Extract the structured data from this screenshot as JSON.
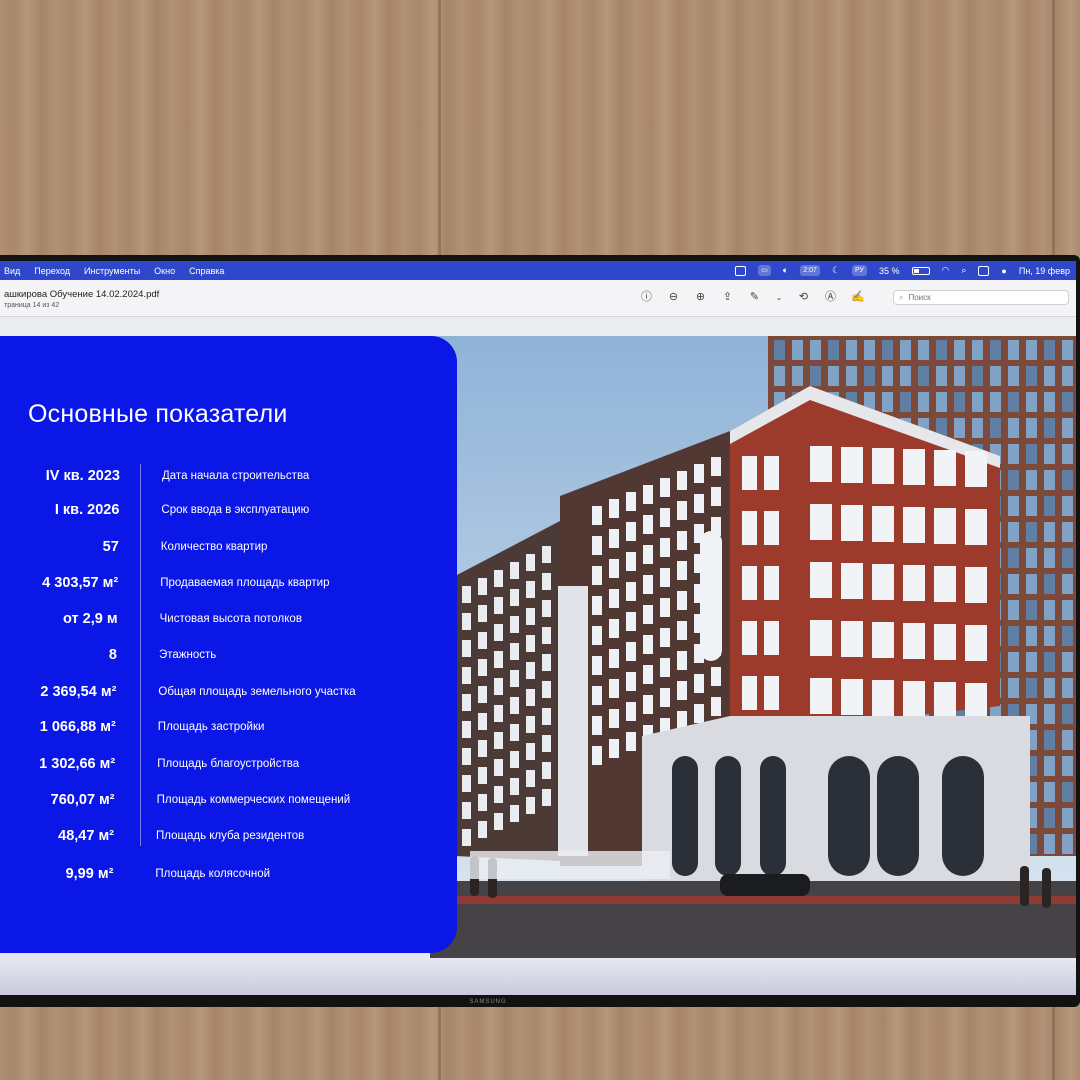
{
  "menubar": {
    "items": [
      "Вид",
      "Переход",
      "Инструменты",
      "Окно",
      "Справка"
    ],
    "status": {
      "pill_a": "2:07",
      "language": "РУ",
      "battery": "35 %",
      "clock": "Пн, 19 февр"
    }
  },
  "toolbar": {
    "doc_title": "ашкирова Обучение 14.02.2024.pdf",
    "page_info": "траница 14 из 42",
    "search_placeholder": "Поиск",
    "icons": [
      "info-icon",
      "zoom-out-icon",
      "zoom-in-icon",
      "share-icon",
      "markup-pen-icon",
      "chevron-down-icon",
      "rotate-icon",
      "annotate-icon",
      "form-fill-icon"
    ]
  },
  "device": {
    "brand": "SAMSUNG"
  },
  "slide": {
    "title": "Основные показатели",
    "rows": [
      {
        "value": "IV кв. 2023",
        "label": "Дата начала строительства"
      },
      {
        "value": "I кв. 2026",
        "label": "Срок ввода в эксплуатацию"
      },
      {
        "value": "57",
        "label": "Количество квартир"
      },
      {
        "value": "4 303,57 м²",
        "label": "Продаваемая площадь квартир"
      },
      {
        "value": "от 2,9 м",
        "label": "Чистовая высота потолков"
      },
      {
        "value": "8",
        "label": "Этажность"
      },
      {
        "value": "2 369,54 м²",
        "label": "Общая площадь земельного участка"
      },
      {
        "value": "1 066,88 м²",
        "label": "Площадь застройки"
      },
      {
        "value": "1 302,66 м²",
        "label": "Площадь благоустройства"
      },
      {
        "value": "760,07 м²",
        "label": "Площадь коммерческих помещений"
      },
      {
        "value": "48,47 м²",
        "label": "Площадь клуба резидентов"
      },
      {
        "value": "9,99 м²",
        "label": "Площадь колясочной"
      }
    ]
  },
  "colors": {
    "panel_blue": "#0a17e6",
    "menubar_blue": "#2e48c9",
    "brick": "#9c3b2c",
    "stone": "#d9dbe0"
  }
}
